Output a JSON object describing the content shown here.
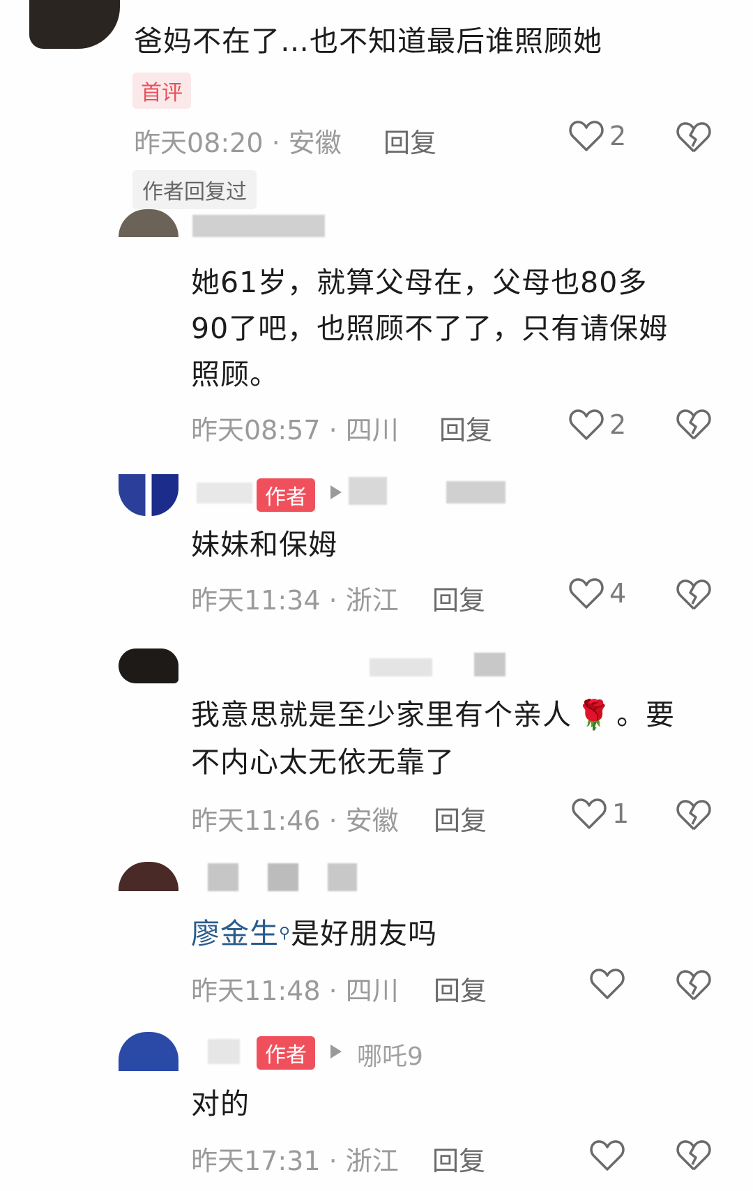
{
  "comments": [
    {
      "text": "爸妈不在了…也不知道最后谁照顾她",
      "badge": "首评",
      "time": "昨天08:20",
      "location": "安徽",
      "reply": "回复",
      "likes": "2",
      "author_replied": "作者回复过"
    },
    {
      "text_lines": [
        "她61岁，就算父母在，父母也80多",
        "90了吧，也照顾不了了，只有请保姆",
        "照顾。"
      ],
      "time": "昨天08:57",
      "location": "四川",
      "reply": "回复",
      "likes": "2"
    },
    {
      "author_tag": "作者",
      "text": "妹妹和保姆",
      "time": "昨天11:34",
      "location": "浙江",
      "reply": "回复",
      "likes": "4"
    },
    {
      "text_lines": [
        "我意思就是至少家里有个亲人",
        "不内心太无依无靠了"
      ],
      "text_suffix": "。要",
      "emoji": "🌹",
      "time": "昨天11:46",
      "location": "安徽",
      "reply": "回复",
      "likes": "1"
    },
    {
      "mention": "廖金生",
      "text": "是好朋友吗",
      "time": "昨天11:48",
      "location": "四川",
      "reply": "回复",
      "likes": ""
    },
    {
      "author_tag": "作者",
      "reply_to": "哪吒9",
      "text": "对的",
      "time": "昨天17:31",
      "location": "浙江",
      "reply": "回复"
    }
  ],
  "colors": {
    "badge_red": "#f0505c",
    "mention_blue": "#2a5b8c",
    "meta_gray": "#9a9a9a"
  }
}
